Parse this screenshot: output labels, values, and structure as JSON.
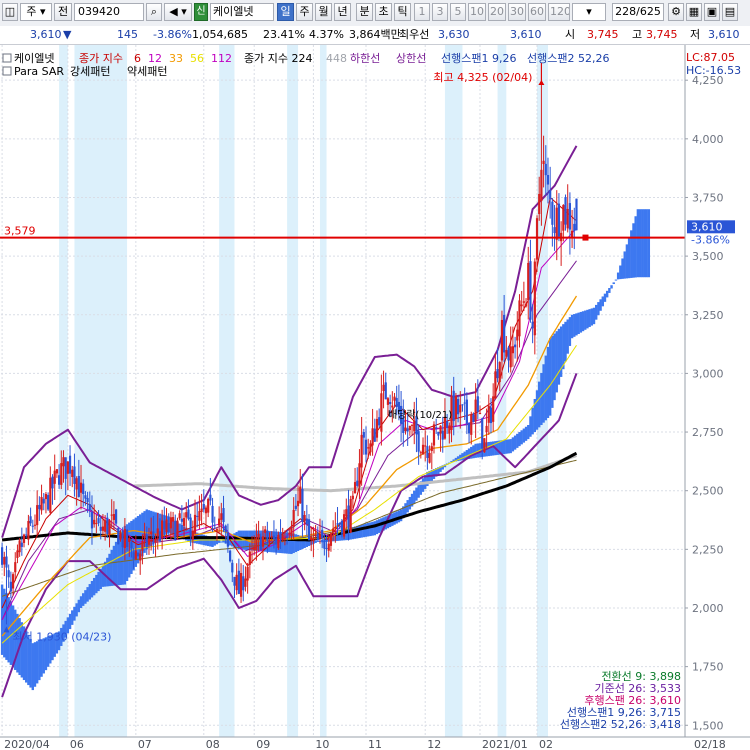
{
  "toolbar": {
    "market": "주",
    "mode": "전",
    "code": "039420",
    "badge": "신",
    "name": "케이엘넷",
    "periods": [
      "일",
      "주",
      "월",
      "년",
      "분",
      "초",
      "틱"
    ],
    "selected_period": "일",
    "intervals": [
      "1",
      "3",
      "5",
      "10",
      "20",
      "30",
      "60",
      "120"
    ],
    "count": "228/625"
  },
  "quote": {
    "price": "3,610",
    "arrow": "▼",
    "change": "145",
    "change_pct": "-3.86%",
    "volume": "1,054,685",
    "volume_pct": "23.41%",
    "turnover": "4.37%",
    "amount": "3,864백만",
    "best_ask_label": "최우선",
    "best_ask": "3,630",
    "best_bid": "3,610",
    "open_label": "시",
    "open": "3,745",
    "high_label": "고",
    "high": "3,745",
    "low_label": "저",
    "low": "3,610"
  },
  "chart_data": {
    "type": "candlestick",
    "title": "케이엘넷",
    "legend": {
      "ma_label": "종가 지수",
      "ma_periods": [
        "6",
        "12",
        "33",
        "56",
        "112"
      ],
      "ma224_label": "종가 지수 224",
      "ma448": "448",
      "lower_limit": "하한선",
      "upper_limit": "상한선",
      "span1": "선행스팬1 9,26",
      "span2": "선행스팬2 52,26",
      "sar": "Para SAR",
      "strong": "강세패턴",
      "weak": "약세패턴"
    },
    "colors": {
      "up": "#d61f1f",
      "down": "#2a55d6",
      "cloud": "#3d78f0",
      "ma6": "#c80000",
      "ma12": "#c000c0",
      "ma33": "#f29a00",
      "ma56": "#e8e000",
      "ma112": "#7a6a2a",
      "ma224": "#000000",
      "ma448": "#c0c0c0",
      "band": "#7a1f95",
      "stripe": "#dcf0fb",
      "hline": "#e00000"
    },
    "y_range": [
      1450,
      4400
    ],
    "y_ticks": [
      1500,
      1750,
      2000,
      2250,
      2500,
      2750,
      3000,
      3250,
      3500,
      3750,
      4000,
      4250
    ],
    "y_tick_labels": [
      "1,500",
      "1,750",
      "2,000",
      "2,250",
      "2,500",
      "2,750",
      "3,000",
      "3,250",
      "3,500",
      "3,750",
      "4,000",
      "4,250"
    ],
    "x_ticks": [
      {
        "label": "2020/04",
        "index": 0
      },
      {
        "label": "06",
        "index": 30
      },
      {
        "label": "07",
        "index": 61
      },
      {
        "label": "08",
        "index": 92
      },
      {
        "label": "09",
        "index": 115
      },
      {
        "label": "10",
        "index": 142
      },
      {
        "label": "11",
        "index": 166
      },
      {
        "label": "12",
        "index": 193
      },
      {
        "label": "2021/01",
        "index": 218
      },
      {
        "label": "02",
        "index": 244
      },
      {
        "label": "02/18",
        "index": 312
      }
    ],
    "max_point": {
      "label": "최고 4,325 (02/04)",
      "value": 4325,
      "index": 246
    },
    "min_point": {
      "label": "최저 1,930 (04/23)",
      "value": 1930,
      "index": 2
    },
    "hline": {
      "value": 3579,
      "label": "3,579"
    },
    "last": {
      "price_label": "3,610",
      "pct_label": "-3.86%",
      "value": 3610,
      "index": 262
    },
    "hc": {
      "lc": "LC:87.05",
      "hc": "HC:-16.53"
    },
    "annotation": "배당락(10/21)",
    "ichimoku": [
      {
        "label": "전환선 9: 3,898",
        "color": "#0a7a2a"
      },
      {
        "label": "기준선 26: 3,533",
        "color": "#6a1fa0"
      },
      {
        "label": "후행스팬 26: 3,610",
        "color": "#c8006a"
      },
      {
        "label": "선행스팬1 9,26: 3,715",
        "color": "#1a3ea8"
      },
      {
        "label": "선행스팬2 52,26: 3,418",
        "color": "#1a3ea8"
      }
    ],
    "last_index": 262,
    "total_slots": 312,
    "series_anchors": {
      "close": [
        [
          0,
          2240
        ],
        [
          4,
          2050
        ],
        [
          8,
          2250
        ],
        [
          14,
          2360
        ],
        [
          20,
          2450
        ],
        [
          26,
          2580
        ],
        [
          32,
          2620
        ],
        [
          38,
          2420
        ],
        [
          44,
          2330
        ],
        [
          50,
          2360
        ],
        [
          56,
          2280
        ],
        [
          62,
          2230
        ],
        [
          68,
          2300
        ],
        [
          74,
          2330
        ],
        [
          80,
          2350
        ],
        [
          88,
          2360
        ],
        [
          94,
          2410
        ],
        [
          100,
          2380
        ],
        [
          104,
          2200
        ],
        [
          108,
          2070
        ],
        [
          112,
          2180
        ],
        [
          118,
          2300
        ],
        [
          124,
          2280
        ],
        [
          130,
          2350
        ],
        [
          136,
          2460
        ],
        [
          140,
          2280
        ],
        [
          146,
          2270
        ],
        [
          150,
          2340
        ],
        [
          156,
          2380
        ],
        [
          160,
          2420
        ],
        [
          164,
          2720
        ],
        [
          168,
          2680
        ],
        [
          172,
          2840
        ],
        [
          176,
          2950
        ],
        [
          180,
          2850
        ],
        [
          184,
          2760
        ],
        [
          188,
          2740
        ],
        [
          194,
          2700
        ],
        [
          200,
          2760
        ],
        [
          206,
          2850
        ],
        [
          212,
          2800
        ],
        [
          216,
          2850
        ],
        [
          220,
          2700
        ],
        [
          224,
          2900
        ],
        [
          228,
          3200
        ],
        [
          232,
          3050
        ],
        [
          236,
          3250
        ],
        [
          240,
          3400
        ],
        [
          242,
          3200
        ],
        [
          244,
          3600
        ],
        [
          246,
          3950
        ],
        [
          248,
          3800
        ],
        [
          252,
          3650
        ],
        [
          256,
          3700
        ],
        [
          260,
          3650
        ],
        [
          262,
          3610
        ]
      ],
      "ma6": [
        [
          0,
          2000
        ],
        [
          10,
          2200
        ],
        [
          20,
          2380
        ],
        [
          30,
          2480
        ],
        [
          40,
          2440
        ],
        [
          50,
          2340
        ],
        [
          62,
          2270
        ],
        [
          76,
          2310
        ],
        [
          92,
          2360
        ],
        [
          104,
          2290
        ],
        [
          112,
          2180
        ],
        [
          122,
          2270
        ],
        [
          136,
          2380
        ],
        [
          148,
          2290
        ],
        [
          160,
          2420
        ],
        [
          170,
          2740
        ],
        [
          180,
          2870
        ],
        [
          192,
          2760
        ],
        [
          204,
          2800
        ],
        [
          216,
          2830
        ],
        [
          224,
          2880
        ],
        [
          234,
          3200
        ],
        [
          242,
          3350
        ],
        [
          250,
          3750
        ],
        [
          262,
          3650
        ]
      ],
      "ma12": [
        [
          0,
          1950
        ],
        [
          12,
          2150
        ],
        [
          24,
          2350
        ],
        [
          36,
          2430
        ],
        [
          48,
          2380
        ],
        [
          62,
          2280
        ],
        [
          80,
          2310
        ],
        [
          100,
          2360
        ],
        [
          112,
          2220
        ],
        [
          124,
          2270
        ],
        [
          138,
          2360
        ],
        [
          150,
          2300
        ],
        [
          162,
          2430
        ],
        [
          172,
          2700
        ],
        [
          184,
          2800
        ],
        [
          196,
          2760
        ],
        [
          210,
          2780
        ],
        [
          224,
          2820
        ],
        [
          236,
          3050
        ],
        [
          246,
          3450
        ],
        [
          262,
          3620
        ]
      ],
      "ma33": [
        [
          0,
          1880
        ],
        [
          20,
          2100
        ],
        [
          40,
          2300
        ],
        [
          60,
          2330
        ],
        [
          80,
          2300
        ],
        [
          100,
          2330
        ],
        [
          114,
          2280
        ],
        [
          134,
          2300
        ],
        [
          150,
          2330
        ],
        [
          166,
          2440
        ],
        [
          180,
          2590
        ],
        [
          196,
          2680
        ],
        [
          212,
          2700
        ],
        [
          226,
          2760
        ],
        [
          240,
          2950
        ],
        [
          250,
          3150
        ],
        [
          262,
          3330
        ]
      ],
      "ma56": [
        [
          0,
          1850
        ],
        [
          30,
          2100
        ],
        [
          60,
          2250
        ],
        [
          90,
          2290
        ],
        [
          120,
          2290
        ],
        [
          150,
          2300
        ],
        [
          170,
          2420
        ],
        [
          190,
          2560
        ],
        [
          210,
          2640
        ],
        [
          230,
          2720
        ],
        [
          250,
          2950
        ],
        [
          262,
          3120
        ]
      ],
      "ma112": [
        [
          0,
          2050
        ],
        [
          40,
          2180
        ],
        [
          80,
          2230
        ],
        [
          120,
          2270
        ],
        [
          160,
          2340
        ],
        [
          200,
          2490
        ],
        [
          240,
          2580
        ],
        [
          262,
          2630
        ]
      ],
      "ma224": [
        [
          0,
          2290
        ],
        [
          30,
          2320
        ],
        [
          60,
          2300
        ],
        [
          100,
          2300
        ],
        [
          140,
          2290
        ],
        [
          170,
          2350
        ],
        [
          190,
          2410
        ],
        [
          210,
          2460
        ],
        [
          230,
          2520
        ],
        [
          250,
          2600
        ],
        [
          262,
          2660
        ]
      ],
      "ma448": [
        [
          60,
          2520
        ],
        [
          90,
          2530
        ],
        [
          120,
          2510
        ],
        [
          150,
          2500
        ],
        [
          180,
          2520
        ],
        [
          210,
          2550
        ],
        [
          240,
          2580
        ],
        [
          262,
          2650
        ]
      ],
      "bb_upper": [
        [
          0,
          2300
        ],
        [
          10,
          2600
        ],
        [
          20,
          2700
        ],
        [
          30,
          2760
        ],
        [
          40,
          2620
        ],
        [
          56,
          2540
        ],
        [
          70,
          2470
        ],
        [
          82,
          2420
        ],
        [
          92,
          2460
        ],
        [
          100,
          2600
        ],
        [
          108,
          2480
        ],
        [
          118,
          2440
        ],
        [
          126,
          2460
        ],
        [
          134,
          2520
        ],
        [
          140,
          2600
        ],
        [
          150,
          2600
        ],
        [
          160,
          2900
        ],
        [
          170,
          3070
        ],
        [
          180,
          3080
        ],
        [
          188,
          3030
        ],
        [
          196,
          2930
        ],
        [
          206,
          2900
        ],
        [
          216,
          2920
        ],
        [
          226,
          3100
        ],
        [
          234,
          3350
        ],
        [
          242,
          3700
        ],
        [
          252,
          3800
        ],
        [
          262,
          3970
        ]
      ],
      "bb_lower": [
        [
          0,
          1620
        ],
        [
          10,
          1890
        ],
        [
          20,
          2080
        ],
        [
          30,
          2200
        ],
        [
          40,
          2200
        ],
        [
          54,
          2080
        ],
        [
          66,
          2080
        ],
        [
          80,
          2170
        ],
        [
          92,
          2210
        ],
        [
          100,
          2120
        ],
        [
          108,
          2000
        ],
        [
          116,
          2030
        ],
        [
          124,
          2120
        ],
        [
          134,
          2180
        ],
        [
          142,
          2050
        ],
        [
          152,
          2050
        ],
        [
          162,
          2050
        ],
        [
          172,
          2300
        ],
        [
          182,
          2500
        ],
        [
          192,
          2560
        ],
        [
          202,
          2570
        ],
        [
          214,
          2650
        ],
        [
          224,
          2690
        ],
        [
          234,
          2600
        ],
        [
          244,
          2700
        ],
        [
          254,
          2800
        ],
        [
          262,
          3000
        ]
      ],
      "bb_mid": [
        [
          0,
          1950
        ],
        [
          12,
          2200
        ],
        [
          26,
          2380
        ],
        [
          40,
          2420
        ],
        [
          56,
          2310
        ],
        [
          70,
          2280
        ],
        [
          86,
          2300
        ],
        [
          100,
          2350
        ],
        [
          110,
          2240
        ],
        [
          124,
          2290
        ],
        [
          138,
          2380
        ],
        [
          150,
          2330
        ],
        [
          162,
          2420
        ],
        [
          176,
          2650
        ],
        [
          190,
          2760
        ],
        [
          204,
          2770
        ],
        [
          218,
          2790
        ],
        [
          232,
          2990
        ],
        [
          244,
          3250
        ],
        [
          262,
          3480
        ]
      ],
      "span1": [
        [
          0,
          2100
        ],
        [
          14,
          1850
        ],
        [
          26,
          1900
        ],
        [
          36,
          2050
        ],
        [
          46,
          2180
        ],
        [
          56,
          2350
        ],
        [
          66,
          2420
        ],
        [
          76,
          2390
        ],
        [
          86,
          2330
        ],
        [
          96,
          2300
        ],
        [
          108,
          2250
        ],
        [
          120,
          2240
        ],
        [
          132,
          2230
        ],
        [
          146,
          2290
        ],
        [
          158,
          2340
        ],
        [
          170,
          2370
        ],
        [
          182,
          2420
        ],
        [
          194,
          2580
        ],
        [
          204,
          2620
        ],
        [
          216,
          2700
        ],
        [
          224,
          2710
        ],
        [
          232,
          2720
        ],
        [
          240,
          2780
        ],
        [
          250,
          3150
        ],
        [
          260,
          3250
        ],
        [
          270,
          3280
        ],
        [
          280,
          3400
        ],
        [
          290,
          3700
        ]
      ],
      "span2": [
        [
          0,
          1800
        ],
        [
          14,
          1650
        ],
        [
          26,
          1820
        ],
        [
          36,
          2000
        ],
        [
          46,
          2090
        ],
        [
          56,
          2100
        ],
        [
          66,
          2250
        ],
        [
          76,
          2320
        ],
        [
          86,
          2280
        ],
        [
          96,
          2260
        ],
        [
          108,
          2330
        ],
        [
          120,
          2330
        ],
        [
          132,
          2320
        ],
        [
          146,
          2280
        ],
        [
          158,
          2290
        ],
        [
          170,
          2310
        ],
        [
          182,
          2370
        ],
        [
          194,
          2520
        ],
        [
          204,
          2620
        ],
        [
          216,
          2640
        ],
        [
          224,
          2650
        ],
        [
          232,
          2660
        ],
        [
          240,
          2720
        ],
        [
          250,
          2820
        ],
        [
          260,
          3150
        ],
        [
          270,
          3210
        ],
        [
          280,
          3400
        ],
        [
          290,
          3410
        ]
      ]
    }
  }
}
